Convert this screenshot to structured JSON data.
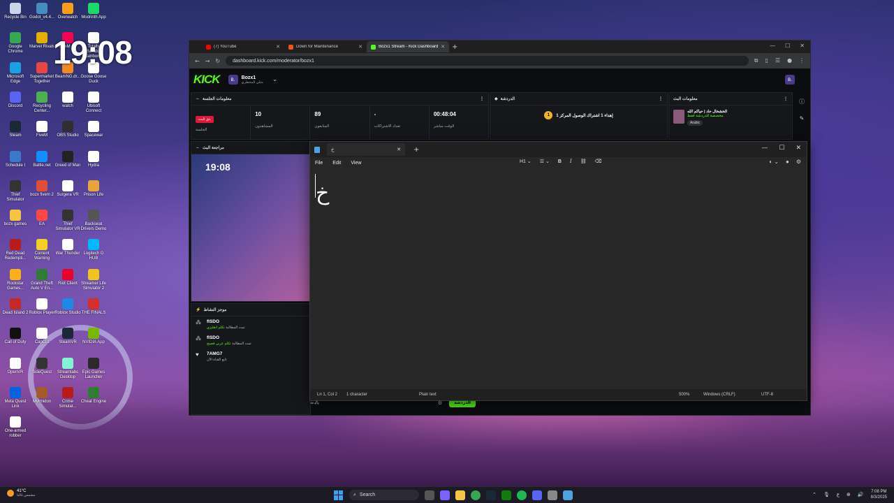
{
  "desktop": {
    "clock_overlay": "19:08",
    "icons": [
      {
        "label": "Recycle Bin",
        "color": "#c9d4e6"
      },
      {
        "label": "Godot_v4.4...",
        "color": "#478cbf"
      },
      {
        "label": "Overwatch",
        "color": "#f99e1a"
      },
      {
        "label": "Modrinth App",
        "color": "#1bd96a"
      },
      {
        "label": "Google Chrome",
        "color": "#34a853"
      },
      {
        "label": "Marvel Rivals",
        "color": "#e3b000"
      },
      {
        "label": "FiveM (2)",
        "color": "#f40552"
      },
      {
        "label": "Totally Reliable Rainbow...",
        "color": "#ffffff"
      },
      {
        "label": "Microsoft Edge",
        "color": "#1ba1e2"
      },
      {
        "label": "Supermarket Together",
        "color": "#e84545"
      },
      {
        "label": "BeamNG.dr...",
        "color": "#f08a24"
      },
      {
        "label": "Goose Goose Duck",
        "color": "#ffffff"
      },
      {
        "label": "Discord",
        "color": "#5865f2"
      },
      {
        "label": "Recycling Center...",
        "color": "#4caf50"
      },
      {
        "label": "watch",
        "color": "#ffffff"
      },
      {
        "label": "Ubisoft Connect",
        "color": "#ffffff"
      },
      {
        "label": "Steam",
        "color": "#1b2838"
      },
      {
        "label": "FiveM",
        "color": "#ffffff"
      },
      {
        "label": "OBS Studio",
        "color": "#302e31"
      },
      {
        "label": "Spacewar",
        "color": "#ffffff"
      },
      {
        "label": "Schedule I",
        "color": "#3a78c9"
      },
      {
        "label": "Battle.net",
        "color": "#148eff"
      },
      {
        "label": "Greed of Man",
        "color": "#222222"
      },
      {
        "label": "Hydra",
        "color": "#ffffff"
      },
      {
        "label": "Thief Simulator",
        "color": "#333333"
      },
      {
        "label": "bozx fivem 2",
        "color": "#e04e39"
      },
      {
        "label": "Surgera VR",
        "color": "#ffffff"
      },
      {
        "label": "Prison Life",
        "color": "#e8a33d"
      },
      {
        "label": "bozx games",
        "color": "#f5c542"
      },
      {
        "label": "EA",
        "color": "#ff4747"
      },
      {
        "label": "Thief Simulator VR",
        "color": "#333333"
      },
      {
        "label": "Backseat Drivers Demo",
        "color": "#555555"
      },
      {
        "label": "Red Dead Redempti...",
        "color": "#b71c1c"
      },
      {
        "label": "Content Warning",
        "color": "#f2d024"
      },
      {
        "label": "War Thunder",
        "color": "#ffffff"
      },
      {
        "label": "Logitech G HUB",
        "color": "#00b8fc"
      },
      {
        "label": "Rockstar Games...",
        "color": "#fcaf17"
      },
      {
        "label": "Grand Theft Auto V En...",
        "color": "#2e7d32"
      },
      {
        "label": "Riot Client",
        "color": "#eb0029"
      },
      {
        "label": "Streamer Life Simulator 2",
        "color": "#f0c419"
      },
      {
        "label": "Dead Island 2",
        "color": "#c62828"
      },
      {
        "label": "Roblox Player",
        "color": "#ffffff"
      },
      {
        "label": "Roblox Studio",
        "color": "#1e88e5"
      },
      {
        "label": "THE FINALS",
        "color": "#d32f2f"
      },
      {
        "label": "Call of Duty",
        "color": "#111111"
      },
      {
        "label": "CapCut",
        "color": "#ffffff"
      },
      {
        "label": "SteamVR",
        "color": "#1b2838"
      },
      {
        "label": "NVIDIA App",
        "color": "#76b900"
      },
      {
        "label": "OpenVR",
        "color": "#ffffff"
      },
      {
        "label": "SideQuest",
        "color": "#333333"
      },
      {
        "label": "Streamlabs Desktop",
        "color": "#80f5d2"
      },
      {
        "label": "Epic Games Launcher",
        "color": "#2a2a2a"
      },
      {
        "label": "Meta Quest Link",
        "color": "#0064e0"
      },
      {
        "label": "Myrmidon",
        "color": "#a35b2c"
      },
      {
        "label": "Crime Simulat...",
        "color": "#b71c1c"
      },
      {
        "label": "Cheat Engine",
        "color": "#2e7d32"
      },
      {
        "label": "One-armed robber",
        "color": "#ffffff"
      }
    ]
  },
  "browser": {
    "tabs": [
      {
        "label": "(7) YouTube",
        "favicon_color": "#ff0000"
      },
      {
        "label": "Down for Maintenance",
        "favicon_color": "#f4511e"
      },
      {
        "label": "Bozx1 Stream - Kick Dashboard",
        "favicon_color": "#53fc18"
      }
    ],
    "new_tab": "+",
    "url": "dashboard.kick.com/moderator/bozx1"
  },
  "kick": {
    "logo": "KICK",
    "channel_avatar": "B.",
    "channel_name": "Bozx1",
    "channel_sub": "مثلي المحطري",
    "session_panel": {
      "title": "معلومات الجلسة",
      "live_badge": "بثق البث",
      "live_label": "الجلسة",
      "stats": [
        {
          "value": "10",
          "label": "المشاهدون"
        },
        {
          "value": "89",
          "label": "المتابعون"
        },
        {
          "value": "-",
          "label": "تعداد الاشتراكات"
        },
        {
          "value": "00:48:04",
          "label": "الوقت مباشر"
        }
      ]
    },
    "chat_panel": {
      "title": "الدردشة",
      "pinned_badge": "1",
      "pinned_text": "إهداء 1 اشتراك الوصول المركز 1"
    },
    "stream_info_panel": {
      "title": "معلومات البث",
      "stream_title": "الخشخال حاد | حياكم الله",
      "category": "مخصصة للدردشة فقط",
      "language": "Arabic"
    },
    "preview_panel": {
      "title": "مراجعة البث",
      "mini_clock": "19:08"
    },
    "activity_panel": {
      "title": "موجز النشاط",
      "items": [
        {
          "name": "flSDO",
          "desc_prefix": "تمت المطالبة",
          "desc_highlight": "تكلم انقليزي"
        },
        {
          "name": "flSDO",
          "desc_prefix": "تمت المطالبة",
          "desc_highlight": "تكلم عربي فصيح"
        },
        {
          "name": "7AMG7",
          "desc_prefix": "تابع القناة الآن",
          "desc_highlight": ""
        }
      ]
    },
    "chat_send": "الدردشة"
  },
  "notepad": {
    "tab_title": "خ",
    "menu": [
      "File",
      "Edit",
      "View"
    ],
    "heading_select": "H1",
    "content": "خ",
    "status": {
      "position": "Ln 1, Col 2",
      "chars": "1 character",
      "format": "Plain text",
      "zoom": "500%",
      "line_ending": "Windows (CRLF)",
      "encoding": "UTF-8"
    }
  },
  "taskbar": {
    "weather_temp": "41°C",
    "weather_desc": "مشمس غالبا",
    "search_placeholder": "Search",
    "lang": "ع",
    "time": "7:08 PM",
    "date": "8/3/2025"
  }
}
